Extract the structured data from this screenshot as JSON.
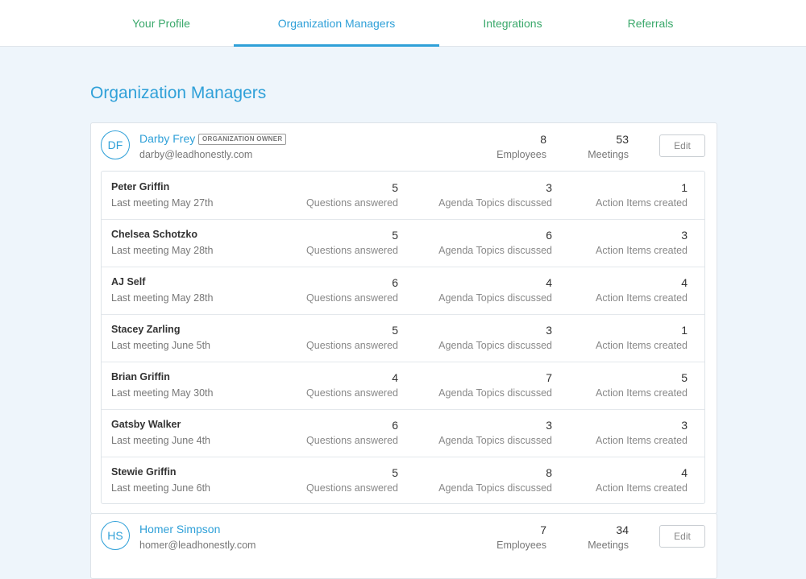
{
  "tabs": [
    {
      "label": "Your Profile"
    },
    {
      "label": "Organization Managers"
    },
    {
      "label": "Integrations"
    },
    {
      "label": "Referrals"
    }
  ],
  "page": {
    "title": "Organization Managers"
  },
  "labels": {
    "employees": "Employees",
    "meetings": "Meetings",
    "edit": "Edit",
    "questions": "Questions answered",
    "agenda": "Agenda Topics discussed",
    "actions": "Action Items created"
  },
  "managers": [
    {
      "initials": "DF",
      "name": "Darby Frey",
      "badge": "ORGANIZATION OWNER",
      "email": "darby@leadhonestly.com",
      "employees": "8",
      "meetings": "53",
      "reports": [
        {
          "name": "Peter Griffin",
          "last": "Last meeting May 27th",
          "questions": "5",
          "agenda": "3",
          "actions": "1"
        },
        {
          "name": "Chelsea Schotzko",
          "last": "Last meeting May 28th",
          "questions": "5",
          "agenda": "6",
          "actions": "3"
        },
        {
          "name": "AJ Self",
          "last": "Last meeting May 28th",
          "questions": "6",
          "agenda": "4",
          "actions": "4"
        },
        {
          "name": "Stacey Zarling",
          "last": "Last meeting June 5th",
          "questions": "5",
          "agenda": "3",
          "actions": "1"
        },
        {
          "name": "Brian Griffin",
          "last": "Last meeting May 30th",
          "questions": "4",
          "agenda": "7",
          "actions": "5"
        },
        {
          "name": "Gatsby Walker",
          "last": "Last meeting June 4th",
          "questions": "6",
          "agenda": "3",
          "actions": "3"
        },
        {
          "name": "Stewie Griffin",
          "last": "Last meeting June 6th",
          "questions": "5",
          "agenda": "8",
          "actions": "4"
        }
      ]
    },
    {
      "initials": "HS",
      "name": "Homer Simpson",
      "email": "homer@leadhonestly.com",
      "employees": "7",
      "meetings": "34"
    }
  ],
  "colors": {
    "accent": "#2fa0d8",
    "tab_green": "#3aa86b",
    "background": "#eef5fb"
  }
}
